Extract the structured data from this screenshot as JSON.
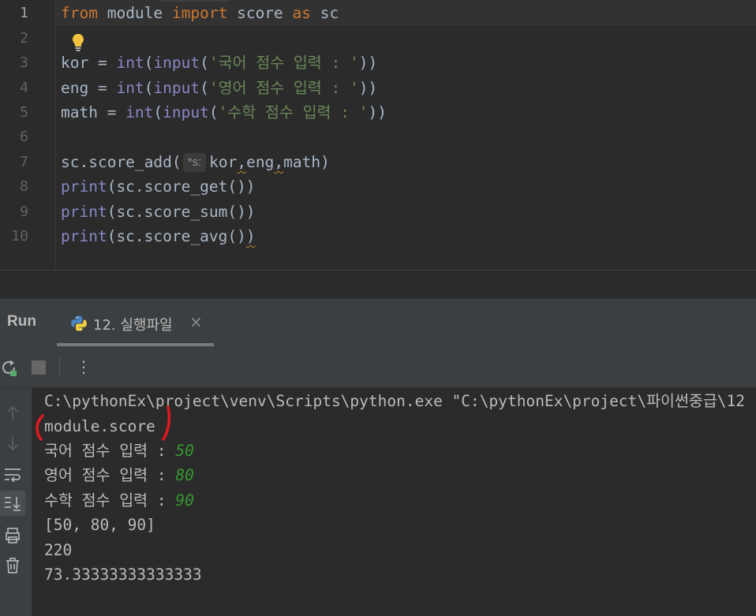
{
  "editor": {
    "line_numbers": [
      "1",
      "2",
      "3",
      "4",
      "5",
      "6",
      "7",
      "8",
      "9",
      "10"
    ],
    "lines": {
      "l1": {
        "kw1": "from",
        "mod": " module ",
        "kw2": "import",
        "name": " score ",
        "kw3": "as",
        "alias": " sc"
      },
      "l3": {
        "var": "kor = ",
        "fn1": "int",
        "p1": "(",
        "fn2": "input",
        "p2": "(",
        "str": "'국어 점수 입력 : '",
        "p3": "))"
      },
      "l4": {
        "var": "eng = ",
        "fn1": "int",
        "p1": "(",
        "fn2": "input",
        "p2": "(",
        "str": "'영어 점수 입력 : '",
        "p3": "))"
      },
      "l5": {
        "var": "math = ",
        "fn1": "int",
        "p1": "(",
        "fn2": "input",
        "p2": "(",
        "str": "'수학 점수 입력 : '",
        "p3": "))"
      },
      "l7": {
        "call": "sc.score_add(",
        "hint": "*s:",
        "a1": "kor",
        "c1": ",",
        "a2": "eng",
        "c2": ",",
        "a3": "math)"
      },
      "l8": {
        "fn": "print",
        "rest": "(sc.score_get())"
      },
      "l9": {
        "fn": "print",
        "rest": "(sc.score_sum())"
      },
      "l10": {
        "fn": "print",
        "rest": "(sc.score_avg()",
        "end": ")"
      }
    }
  },
  "run": {
    "title": "Run",
    "tab_label": "12. 실행파일",
    "tab_close": "×",
    "more": "⋮"
  },
  "console": {
    "lines": [
      {
        "text": "C:\\pythonEx\\project\\venv\\Scripts\\python.exe \"C:\\pythonEx\\project\\파이썬중급\\12"
      },
      {
        "text": "module.score"
      },
      {
        "text": "국어 점수 입력 : ",
        "input": "50"
      },
      {
        "text": "영어 점수 입력 : ",
        "input": "80"
      },
      {
        "text": "수학 점수 입력 : ",
        "input": "90"
      },
      {
        "text": "[50, 80, 90]"
      },
      {
        "text": "220"
      },
      {
        "text": "73.33333333333333"
      }
    ]
  },
  "colors": {
    "keyword": "#cc7832",
    "builtin": "#8888c6",
    "string": "#6a8759",
    "input": "#35992f",
    "annotation": "#e0191f"
  }
}
